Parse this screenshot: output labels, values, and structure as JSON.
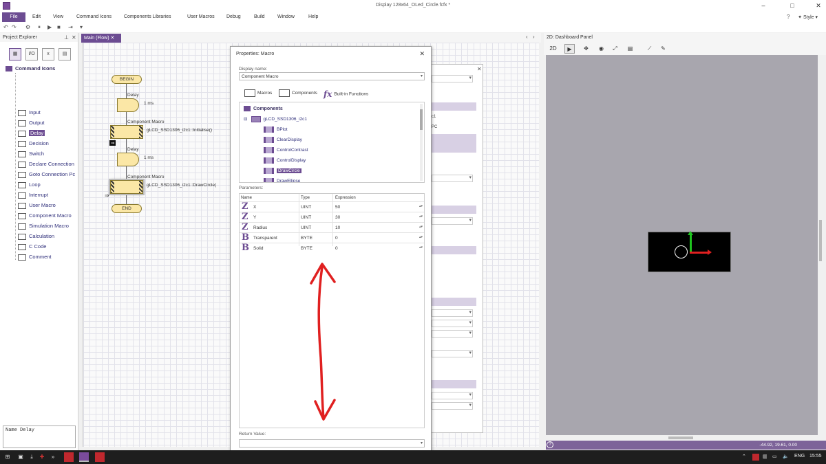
{
  "window": {
    "title": "Display 128x64_OLed_Circle.fcfx *",
    "style_label": "Style"
  },
  "menu": [
    "File",
    "Edit",
    "View",
    "Command Icons",
    "Components Libraries",
    "User Macros",
    "Debug",
    "Build",
    "Window",
    "Help"
  ],
  "explorer": {
    "title": "Project Explorer",
    "root": "Command Icons",
    "items": [
      {
        "label": "Input",
        "icon": "input-icon"
      },
      {
        "label": "Output",
        "icon": "output-icon"
      },
      {
        "label": "Delay",
        "icon": "delay-icon",
        "selected": true
      },
      {
        "label": "Decision",
        "icon": "decision-icon"
      },
      {
        "label": "Switch",
        "icon": "switch-icon"
      },
      {
        "label": "Declare Connection",
        "icon": "declare-connection-icon"
      },
      {
        "label": "Goto Connection Pc",
        "icon": "goto-connection-icon"
      },
      {
        "label": "Loop",
        "icon": "loop-icon"
      },
      {
        "label": "Interrupt",
        "icon": "interrupt-icon"
      },
      {
        "label": "User Macro",
        "icon": "user-macro-icon"
      },
      {
        "label": "Component Macro",
        "icon": "component-macro-icon"
      },
      {
        "label": "Simulation Macro",
        "icon": "simulation-macro-icon"
      },
      {
        "label": "Calculation",
        "icon": "calculation-icon"
      },
      {
        "label": "C Code",
        "icon": "c-code-icon"
      },
      {
        "label": "Comment",
        "icon": "comment-icon"
      }
    ],
    "name_box": "Name Delay"
  },
  "flow": {
    "tab": "Main (Flow)",
    "begin": "BEGIN",
    "end": "END",
    "delay1_title": "Delay",
    "delay1_value": "1 ms",
    "macro1_title": "Component Macro",
    "macro1_call": "gLCD_SSD1306_i2c1::Initialise()",
    "delay2_title": "Delay",
    "delay2_value": "1 ms",
    "macro2_title": "Component Macro",
    "macro2_call": "gLCD_SSD1306_i2c1::DrawCircle("
  },
  "properties": {
    "title": "Properties: Macro",
    "display_name_label": "Display name:",
    "display_name_value": "Component Macro",
    "source_tabs": [
      "Macros",
      "Components",
      "Built-in Functions"
    ],
    "tree_root": "Components",
    "component": "gLCD_SSD1306_i2c1",
    "macros": [
      "BPlot",
      "ClearDisplay",
      "ControlContrast",
      "ControlDisplay",
      "DrawCircle",
      "DrawEllipse"
    ],
    "selected_macro": "DrawCircle",
    "parameters_label": "Parameters:",
    "columns": [
      "Name",
      "Type",
      "Expression"
    ],
    "parameters": [
      {
        "icon": "Z",
        "name": "X",
        "type": "UINT",
        "expression": "50"
      },
      {
        "icon": "Z",
        "name": "Y",
        "type": "UINT",
        "expression": "30"
      },
      {
        "icon": "Z",
        "name": "Radius",
        "type": "UINT",
        "expression": "10"
      },
      {
        "icon": "B",
        "name": "Transparent",
        "type": "BYTE",
        "expression": "0"
      },
      {
        "icon": "B",
        "name": "Solid",
        "type": "BYTE",
        "expression": "0"
      }
    ],
    "return_value_label": "Return Value:",
    "bg_dialog_text": [
      "c1",
      "PC"
    ]
  },
  "dashboard": {
    "title": "2D: Dashboard Panel",
    "coords": "-44.92, 19.61, 0.00",
    "label_2d": "2D"
  },
  "taskbar": {
    "lang": "ENG",
    "time": "15:55"
  },
  "colors": {
    "accent": "#6c4c92",
    "annotation_arrow": "#e02020",
    "oled_bg": "#000000",
    "dashboard_bg": "#a8a6ae"
  }
}
